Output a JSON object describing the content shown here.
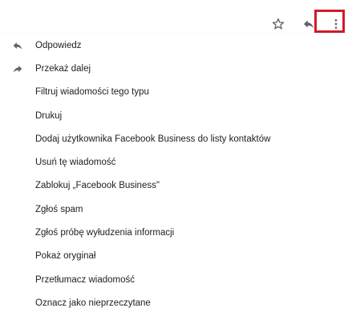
{
  "toolbar": {
    "star_icon": "star-outline-icon",
    "reply_icon": "reply-icon",
    "more_icon": "more-vert-icon",
    "highlight_color": "#d11a2a"
  },
  "menu": {
    "items": [
      {
        "label": "Odpowiedz",
        "icon": "reply-icon"
      },
      {
        "label": "Przekaż dalej",
        "icon": "forward-icon"
      },
      {
        "label": "Filtruj wiadomości tego typu",
        "icon": ""
      },
      {
        "label": "Drukuj",
        "icon": ""
      },
      {
        "label": "Dodaj użytkownika Facebook Business do listy kontaktów",
        "icon": ""
      },
      {
        "label": "Usuń tę wiadomość",
        "icon": ""
      },
      {
        "label": "Zablokuj „Facebook Business\"",
        "icon": ""
      },
      {
        "label": "Zgłoś spam",
        "icon": ""
      },
      {
        "label": "Zgłoś próbę wyłudzenia informacji",
        "icon": ""
      },
      {
        "label": "Pokaż oryginał",
        "icon": ""
      },
      {
        "label": "Przetłumacz wiadomość",
        "icon": ""
      },
      {
        "label": "Oznacz jako nieprzeczytane",
        "icon": ""
      }
    ]
  }
}
